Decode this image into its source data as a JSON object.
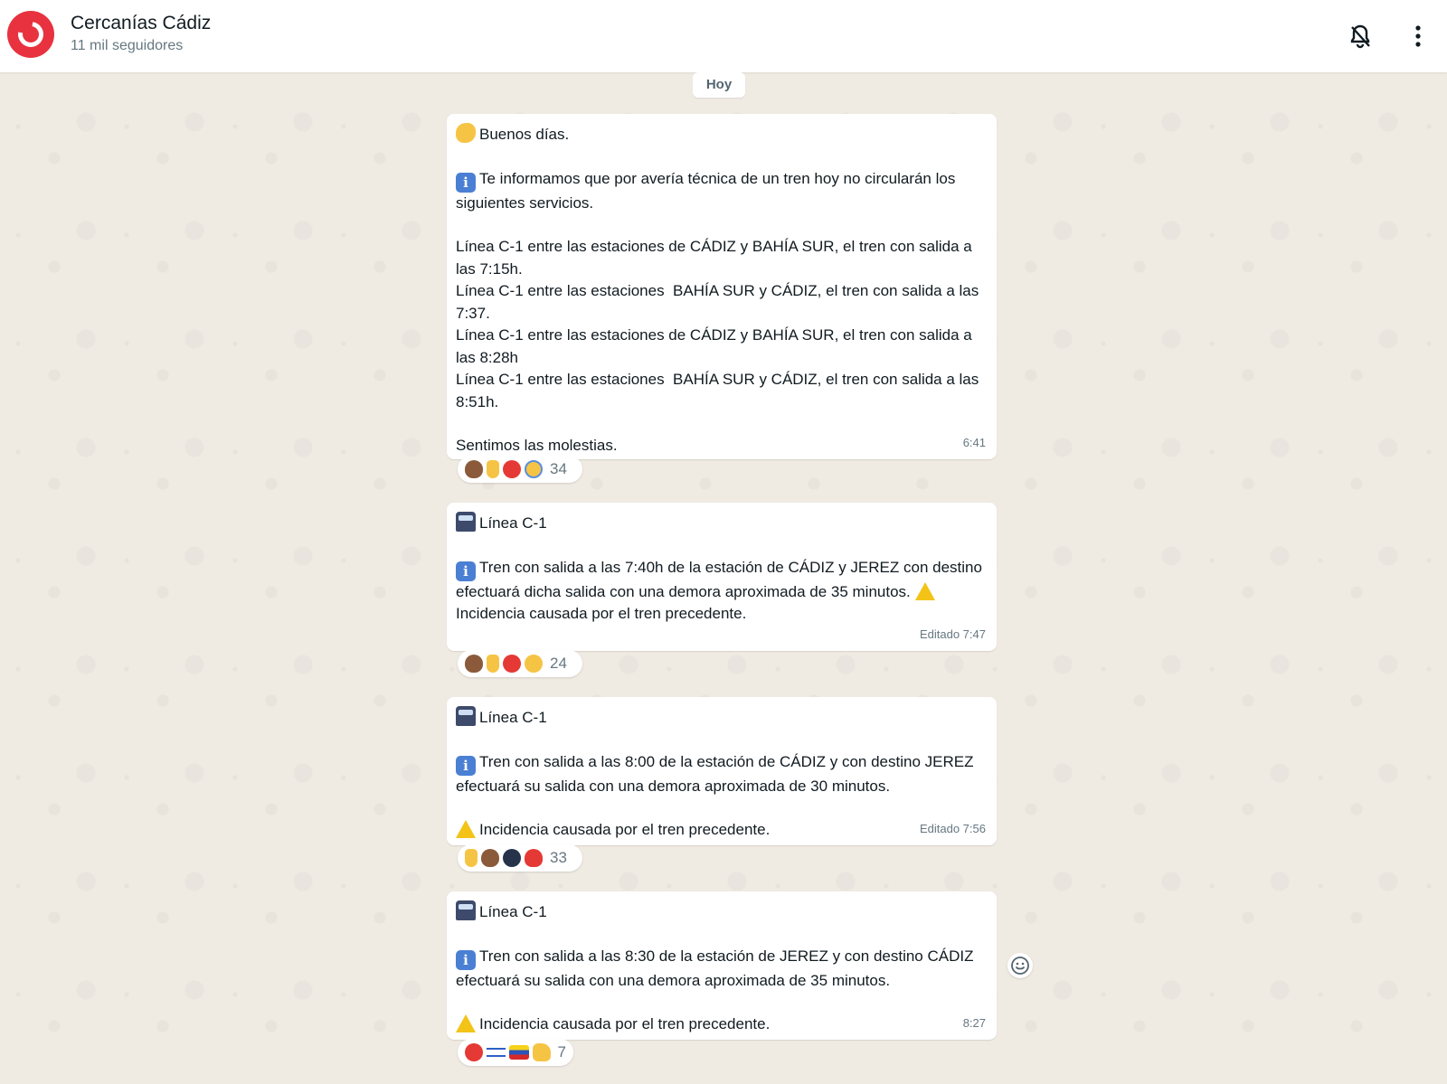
{
  "header": {
    "title": "Cercanías Cádiz",
    "subtitle": "11 mil seguidores",
    "icons": [
      "bell-off-icon",
      "more-vertical-icon"
    ]
  },
  "date_divider": "Hoy",
  "messages": [
    {
      "lines": {
        "greeting": "Buenos días.",
        "intro": "Te informamos que por avería técnica de un tren hoy no circularán los siguientes servicios.",
        "l1": "Línea C-1 entre las estaciones de CÁDIZ y BAHÍA SUR, el tren con salida a las 7:15h.",
        "l2": "Línea C-1 entre las estaciones  BAHÍA SUR y CÁDIZ, el tren con salida a las 7:37.",
        "l3": "Línea C-1 entre las estaciones de CÁDIZ y BAHÍA SUR, el tren con salida a las 8:28h",
        "l4": "Línea C-1 entre las estaciones  BAHÍA SUR y CÁDIZ, el tren con salida a las 8:51h.",
        "closing": "Sentimos las molestias."
      },
      "time": "6:41",
      "reactions": {
        "emojis": [
          "poop",
          "middle-finger",
          "angry-face",
          "screaming-face"
        ],
        "count": "34"
      }
    },
    {
      "lines": {
        "heading": "Línea C-1",
        "body": "Tren con salida a las 7:40h de la estación de CÁDIZ y JEREZ con destino efectuará dicha salida con una demora aproximada de 35 minutos.",
        "warn": "Incidencia causada por el tren precedente."
      },
      "time": "Editado 7:47",
      "reactions": {
        "emojis": [
          "poop",
          "middle-finger",
          "angry-face",
          "astonished-face"
        ],
        "count": "24"
      }
    },
    {
      "lines": {
        "heading": "Línea C-1",
        "body": "Tren con salida a las 8:00 de la estación de CÁDIZ y con destino JEREZ  efectuará su salida con una demora aproximada de 30 minutos.",
        "warn": "Incidencia causada por el tren precedente."
      },
      "time": "Editado 7:56",
      "reactions": {
        "emojis": [
          "middle-finger",
          "poop",
          "bomb",
          "red-heart"
        ],
        "count": "33"
      }
    },
    {
      "lines": {
        "heading": "Línea C-1",
        "body": "Tren con salida a las 8:30 de la estación de JEREZ y con destino CÁDIZ  efectuará su salida con una demora aproximada de 35 minutos.",
        "warn": "Incidencia causada por el tren precedente."
      },
      "time": "8:27",
      "reactions": {
        "emojis": [
          "angry-face",
          "israel-flag",
          "venezuela-flag",
          "thumbs-up"
        ],
        "count": "7"
      }
    }
  ],
  "colors": {
    "brand": "#e8323f",
    "background": "#efeae2",
    "bubble": "#ffffff",
    "meta_text": "#667781"
  }
}
